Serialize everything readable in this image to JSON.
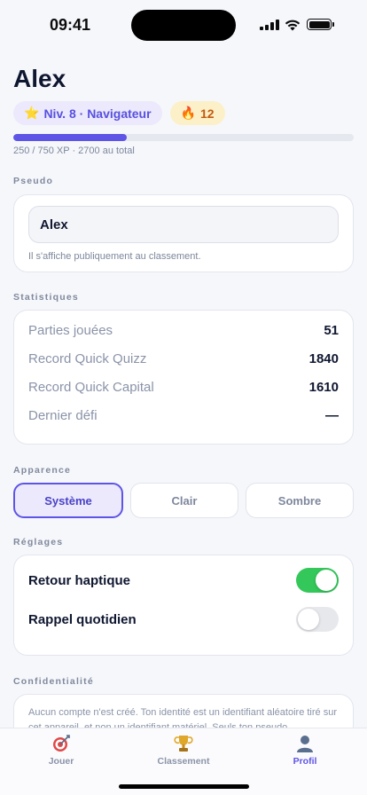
{
  "status": {
    "time": "09:41"
  },
  "profile": {
    "name": "Alex",
    "level_badge": "Niv. 8 · Navigateur",
    "level_emoji": "⭐",
    "streak_emoji": "🔥",
    "streak": "12",
    "xp_text": "250 / 750 XP · 2700 au total",
    "xp_progress": 0.333
  },
  "pseudo": {
    "title": "Pseudo",
    "value": "Alex",
    "help": "Il s'affiche publiquement au classement."
  },
  "stats": {
    "title": "Statistiques",
    "rows": [
      {
        "label": "Parties jouées",
        "value": "51"
      },
      {
        "label": "Record Quick Quizz",
        "value": "1840"
      },
      {
        "label": "Record Quick Capital",
        "value": "1610"
      },
      {
        "label": "Dernier défi",
        "value": "—"
      }
    ]
  },
  "appearance": {
    "title": "Apparence",
    "options": [
      "Système",
      "Clair",
      "Sombre"
    ],
    "selected": "Système"
  },
  "settings": {
    "title": "Réglages",
    "haptic_label": "Retour haptique",
    "haptic_on": true,
    "reminder_label": "Rappel quotidien",
    "reminder_on": false
  },
  "privacy": {
    "title": "Confidentialité",
    "text": "Aucun compte n'est créé. Ton identité est un identifiant aléatoire tiré sur cet appareil, et non un identifiant matériel. Seuls ton pseudo"
  },
  "tabs": [
    {
      "label": "Jouer",
      "icon": "target-icon"
    },
    {
      "label": "Classement",
      "icon": "trophy-icon"
    },
    {
      "label": "Profil",
      "icon": "person-icon",
      "active": true
    }
  ],
  "colors": {
    "accent": "#5e54e6",
    "toggle_on": "#34c759",
    "background": "#f6f7fb"
  }
}
